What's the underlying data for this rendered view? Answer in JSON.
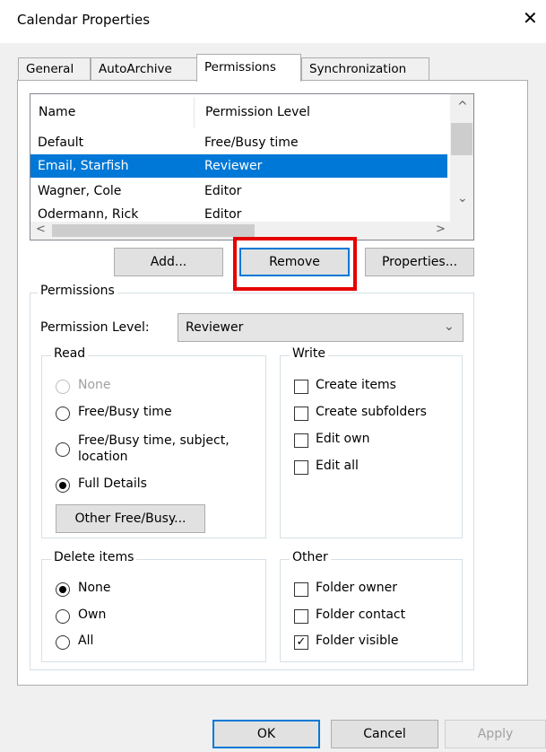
{
  "dialog": {
    "title": "Calendar Properties",
    "close_glyph": "✕"
  },
  "tabs": [
    {
      "label": "General"
    },
    {
      "label": "AutoArchive"
    },
    {
      "label": "Permissions",
      "active": true
    },
    {
      "label": "Synchronization"
    }
  ],
  "list": {
    "columns": [
      "Name",
      "Permission Level"
    ],
    "rows": [
      {
        "name": "Default",
        "level": "Free/Busy time"
      },
      {
        "name": "Email, Starfish",
        "level": "Reviewer",
        "selected": true
      },
      {
        "name": "Wagner, Cole",
        "level": "Editor"
      },
      {
        "name": "Odermann, Rick",
        "level": "Editor"
      }
    ]
  },
  "buttons": {
    "add": "Add...",
    "remove": "Remove",
    "properties": "Properties...",
    "other_freebusy": "Other Free/Busy...",
    "ok": "OK",
    "cancel": "Cancel",
    "apply": "Apply"
  },
  "permissions": {
    "group_label": "Permissions",
    "level_label": "Permission Level:",
    "level_value": "Reviewer",
    "read": {
      "label": "Read",
      "options": [
        "None",
        "Free/Busy time",
        "Free/Busy time, subject,",
        "location",
        "Full Details"
      ],
      "selected": "Full Details"
    },
    "write": {
      "label": "Write",
      "options": [
        "Create items",
        "Create subfolders",
        "Edit own",
        "Edit all"
      ]
    },
    "delete": {
      "label": "Delete items",
      "options": [
        "None",
        "Own",
        "All"
      ],
      "selected": "None"
    },
    "other": {
      "label": "Other",
      "options": [
        "Folder owner",
        "Folder contact",
        "Folder visible"
      ],
      "checked": [
        "Folder visible"
      ]
    }
  },
  "colors": {
    "selection": "#0078d7",
    "highlight": "#e60000"
  },
  "icons": {
    "scroll_up": "^",
    "scroll_down": "⌄",
    "scroll_left": "<",
    "scroll_right": ">",
    "combo_arrow": "⌄",
    "check": "✓"
  }
}
